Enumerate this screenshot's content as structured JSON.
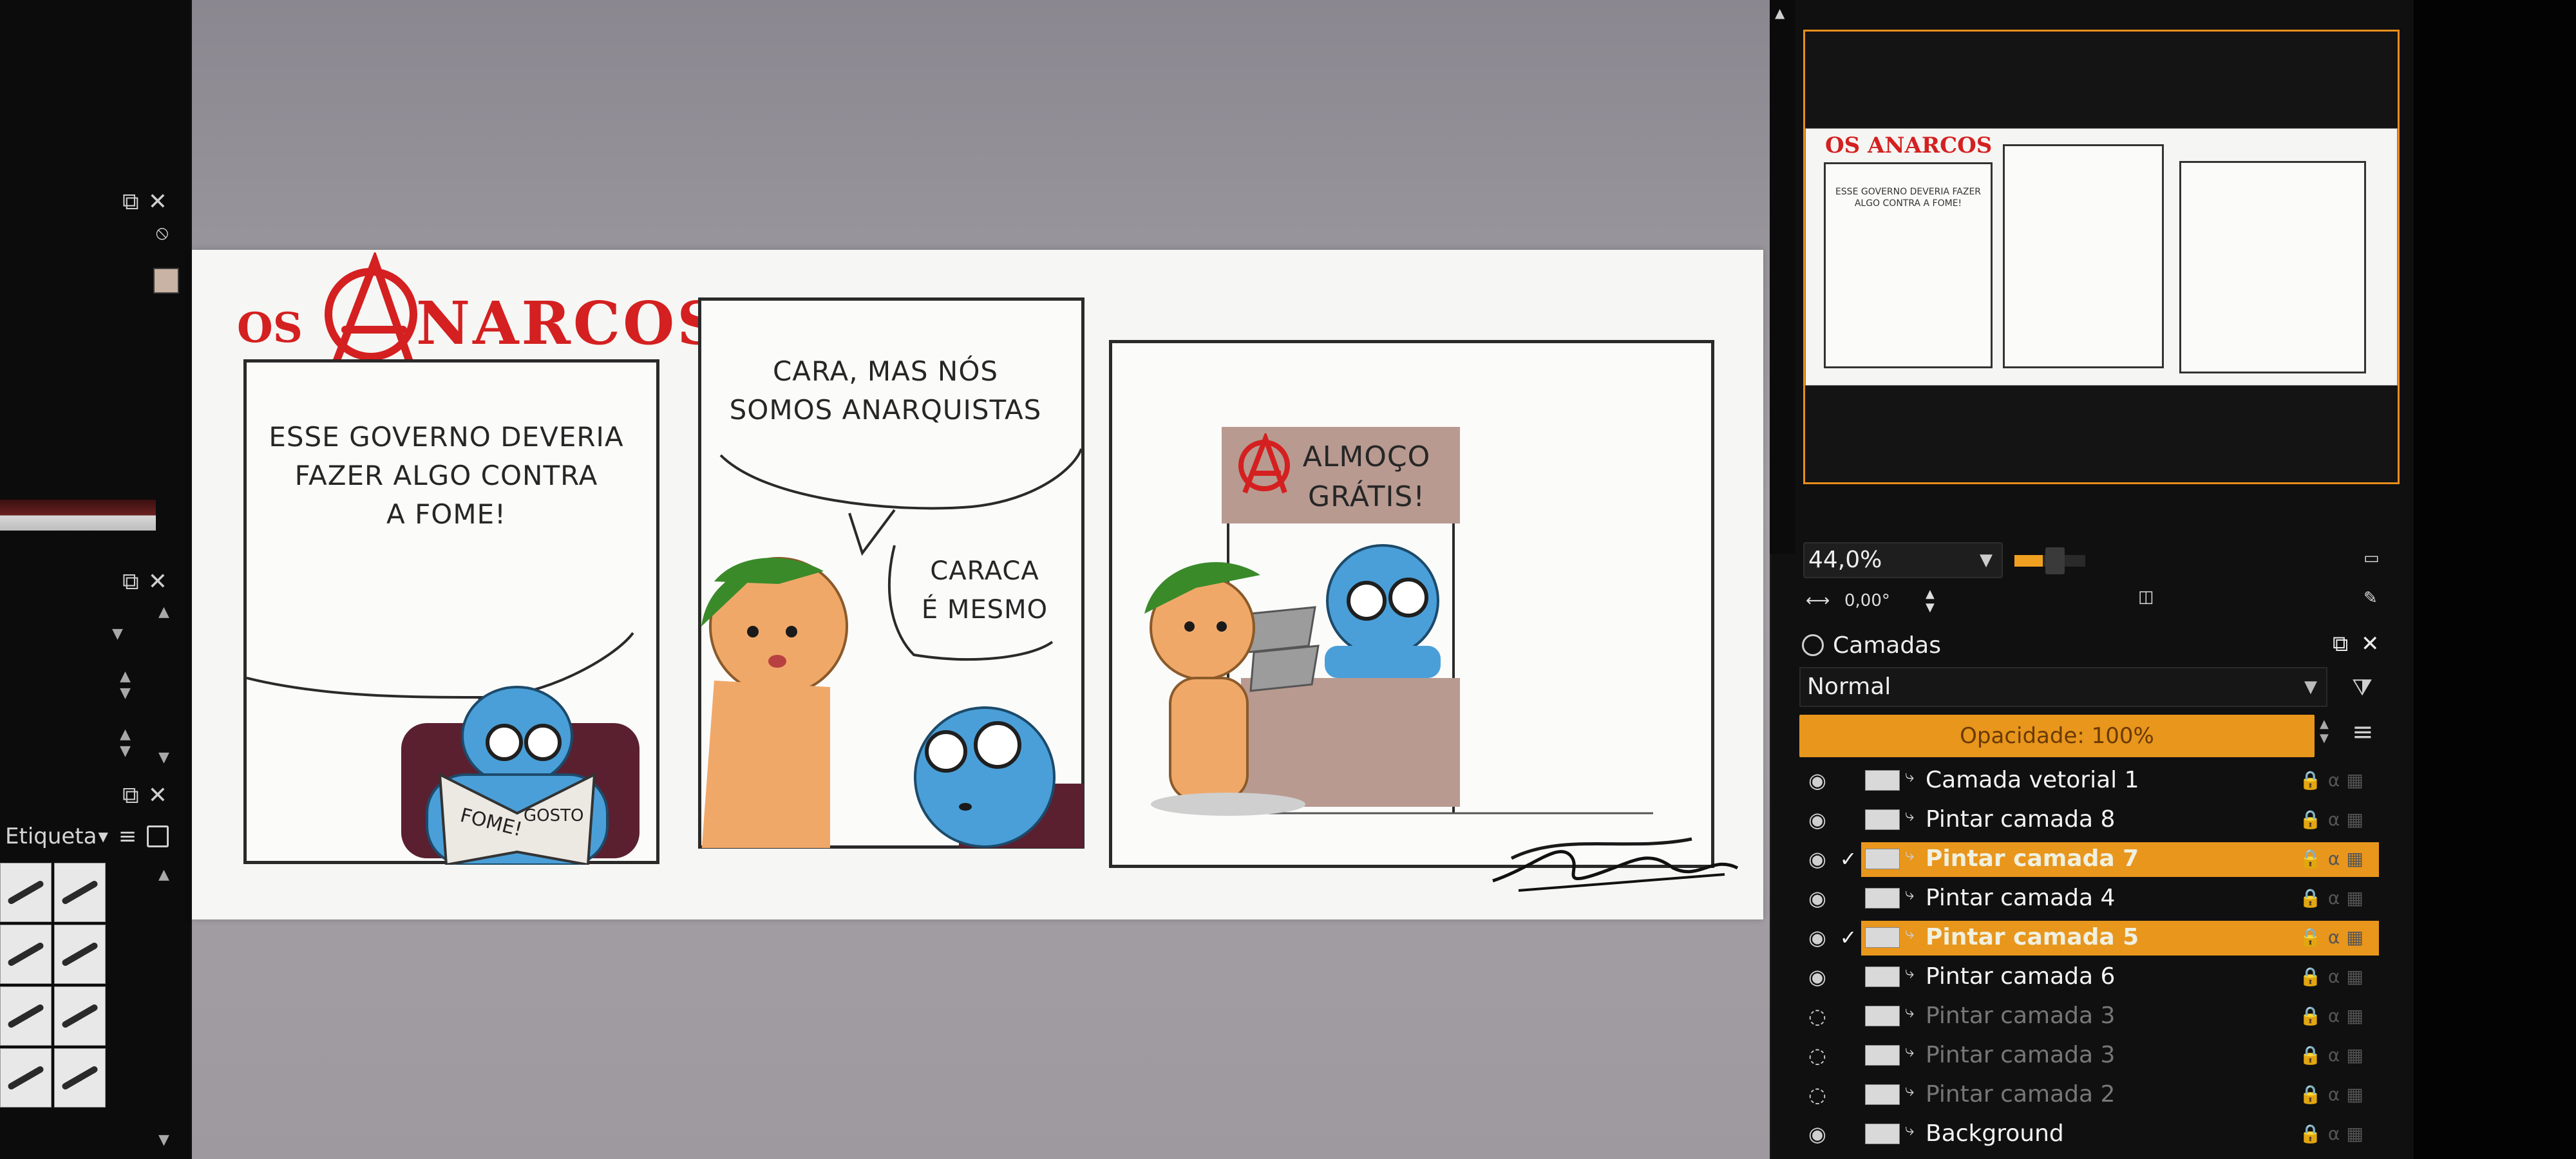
{
  "left_dock": {
    "etiqueta_label": "Etiqueta",
    "icons": [
      "float-icon",
      "close-icon",
      "no-icon",
      "menu-icon",
      "info-icon"
    ]
  },
  "comic": {
    "title": "OS ANARCOS",
    "title_prefix": "OS",
    "title_rest": "NARCOS",
    "panel1_text": "ESSE GOVERNO DEVERIA FAZER ALGO CONTRA A FOME!",
    "panel1_lines": [
      "ESSE GOVERNO DEVERIA",
      "FAZER ALGO CONTRA",
      "A FOME!"
    ],
    "panel2_text1_lines": [
      "CARA, MAS NÓS",
      "SOMOS ANARQUISTAS"
    ],
    "panel2_text2_lines": [
      "CARACA",
      "É MESMO"
    ],
    "sign_lines": [
      "ALMOÇO",
      "GRÁTIS!"
    ],
    "newspaper": [
      "FOME!",
      "GOSTO"
    ]
  },
  "navigator": {
    "zoom_value": "44,0%",
    "zoom_fraction": 0.44,
    "rotation_value": "0,00°"
  },
  "layers": {
    "panel_title": "Camadas",
    "blend_mode": "Normal",
    "opacity_label": "Opacidade:  100%",
    "items": [
      {
        "name": "Camada vetorial 1",
        "state": "normal",
        "checked": false
      },
      {
        "name": "Pintar camada 8",
        "state": "normal",
        "checked": false
      },
      {
        "name": "Pintar camada 7",
        "state": "selected",
        "checked": true
      },
      {
        "name": "Pintar camada 4",
        "state": "normal",
        "checked": false
      },
      {
        "name": "Pintar camada 5",
        "state": "selected",
        "checked": true
      },
      {
        "name": "Pintar camada 6",
        "state": "normal",
        "checked": false
      },
      {
        "name": "Pintar camada 3",
        "state": "hidden",
        "checked": false
      },
      {
        "name": "Pintar camada 3",
        "state": "hidden",
        "checked": false
      },
      {
        "name": "Pintar camada 2",
        "state": "hidden",
        "checked": false
      },
      {
        "name": "Background",
        "state": "normal",
        "checked": false
      }
    ]
  },
  "colors": {
    "accent": "#e8961c",
    "title_red": "#d42020",
    "char_blue": "#4a9fd8",
    "char_orange": "#f0a868",
    "hat_green": "#3a8a2a",
    "chair_maroon": "#5a2030",
    "sign_brown": "#b89a90"
  }
}
